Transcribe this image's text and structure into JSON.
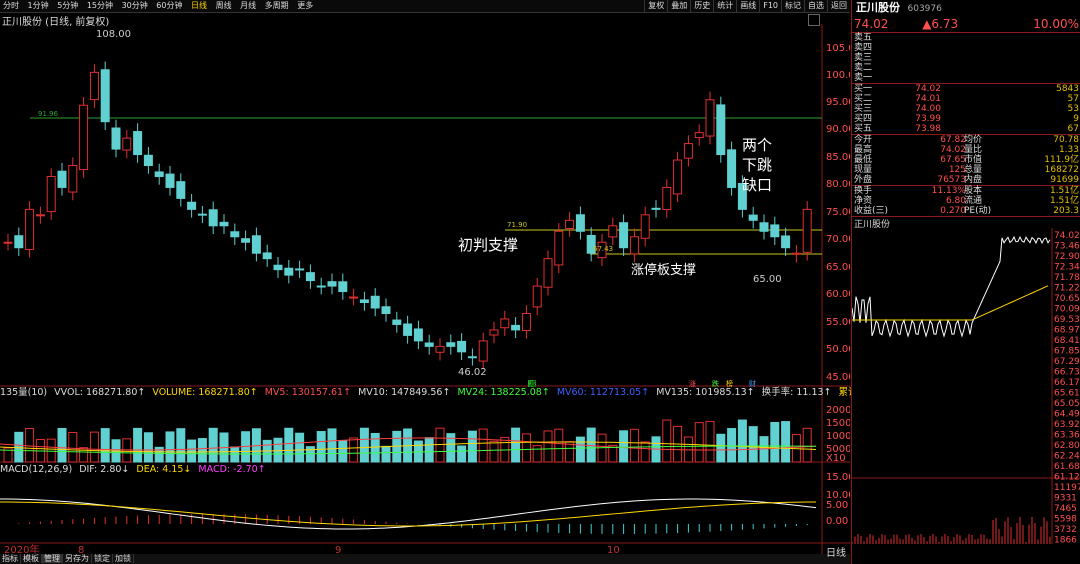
{
  "toolbar": {
    "periods": [
      "分时",
      "1分钟",
      "5分钟",
      "15分钟",
      "30分钟",
      "60分钟",
      "日线",
      "周线",
      "月线",
      "多周期",
      "更多"
    ],
    "buttons": [
      "复权",
      "叠加",
      "历史",
      "统计",
      "画线",
      "F10",
      "标记",
      "自选",
      "返回"
    ]
  },
  "chart_title": "正川股份 (日线, 前复权)",
  "price_axis": [
    "105.00",
    "100.00",
    "95.00",
    "90.00",
    "85.00",
    "80.00",
    "75.00",
    "70.00",
    "65.00",
    "60.00",
    "55.00",
    "50.00",
    "45.00"
  ],
  "level_labels": {
    "line1": "91.96",
    "line2": "71.90",
    "line3": "67.43"
  },
  "markers": {
    "high": "108.00",
    "low": "46.02",
    "recent_low": "65.00"
  },
  "annotations": {
    "gap_line1": "两个",
    "gap_line2": "下跳",
    "gap_line3": "缺口",
    "initial_support": "初判支撑",
    "limit_support": "涨停板支撑"
  },
  "volume_indicator": {
    "name": "135量(10)",
    "vvol": "VVOL: 168271.80↑",
    "volume": "VOLUME: 168271.80↑",
    "mv5": "MV5: 130157.61↑",
    "mv10": "MV10: 147849.56↑",
    "mv24": "MV24: 138225.08↑",
    "mv60": "MV60: 112713.05↑",
    "mv135": "MV135: 101985.13↑",
    "turnover": "换手率: 11.13↑",
    "cum_turnover": "累计换手: 97.",
    "axis": [
      "20000",
      "15000",
      "10000",
      "5000",
      "X10"
    ],
    "flags": [
      "减",
      "涨",
      "跌",
      "榜",
      "财"
    ]
  },
  "macd_indicator": {
    "name": "MACD(12,26,9)",
    "dif": "DIF: 2.80↓",
    "dea": "DEA: 4.15↓",
    "macd": "MACD: -2.70↑",
    "axis": [
      "15.00",
      "10.00",
      "5.00",
      "0.00"
    ]
  },
  "date_axis": [
    "2020年",
    "8",
    "9",
    "10"
  ],
  "bottom_tabs": [
    "指标",
    "模板",
    "管理",
    "另存为",
    "锁定",
    "加锁"
  ],
  "period_label": "日线",
  "quote": {
    "name": "正川股份",
    "code": "603976",
    "price": "74.02",
    "change": "▲6.73",
    "pct": "10.00%",
    "sell": [
      {
        "l": "卖五",
        "p": "",
        "v": ""
      },
      {
        "l": "卖四",
        "p": "",
        "v": ""
      },
      {
        "l": "卖三",
        "p": "",
        "v": ""
      },
      {
        "l": "卖二",
        "p": "",
        "v": ""
      },
      {
        "l": "卖一",
        "p": "",
        "v": ""
      }
    ],
    "buy": [
      {
        "l": "买一",
        "p": "74.02",
        "v": "5843"
      },
      {
        "l": "买二",
        "p": "74.01",
        "v": "57"
      },
      {
        "l": "买三",
        "p": "74.00",
        "v": "53"
      },
      {
        "l": "买四",
        "p": "73.99",
        "v": "9"
      },
      {
        "l": "买五",
        "p": "73.98",
        "v": "67"
      }
    ],
    "stats": [
      {
        "l1": "今开",
        "v1": "67.82",
        "l2": "均价",
        "v2": "70.78"
      },
      {
        "l1": "最高",
        "v1": "74.02",
        "l2": "量比",
        "v2": "1.33"
      },
      {
        "l1": "最低",
        "v1": "67.65",
        "l2": "市值",
        "v2": "111.9亿"
      },
      {
        "l1": "现量",
        "v1": "125",
        "l2": "总量",
        "v2": "168272"
      },
      {
        "l1": "外盘",
        "v1": "76573",
        "l2": "内盘",
        "v2": "91699"
      }
    ],
    "stats2": [
      {
        "l1": "换手",
        "v1": "11.13%",
        "l2": "股本",
        "v2": "1.51亿"
      },
      {
        "l1": "净资",
        "v1": "6.80",
        "l2": "流通",
        "v2": "1.51亿"
      },
      {
        "l1": "收益(三)",
        "v1": "0.270",
        "l2": "PE(动)",
        "v2": "203.3"
      }
    ],
    "mini_title": "正川股份",
    "mini_axis": [
      "74.02",
      "73.46",
      "72.90",
      "72.34",
      "71.78",
      "71.22",
      "70.65",
      "70.09",
      "69.53",
      "68.97",
      "68.41",
      "67.85",
      "67.29",
      "66.73",
      "66.17",
      "65.61",
      "65.05",
      "64.49",
      "63.92",
      "63.36",
      "62.80",
      "62.24",
      "61.68",
      "61.12",
      "11197",
      "9331",
      "7465",
      "5598",
      "3732",
      "1866"
    ]
  }
}
